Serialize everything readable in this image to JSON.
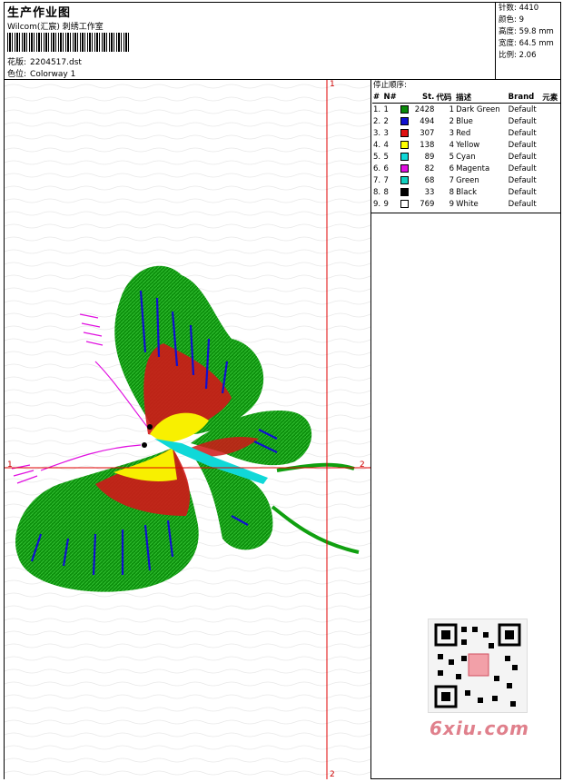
{
  "header": {
    "title": "生产作业图",
    "studio": "Wilcom(汇宸) 刺绣工作室",
    "design_label": "花版:",
    "design_value": "2204517.dst",
    "colorway_label": "色位:",
    "colorway_value": "Colorway 1"
  },
  "stats": {
    "stitches": "针数: 4410",
    "colors": "颜色: 9",
    "height": "高度: 59.8 mm",
    "width": "宽度: 64.5 mm",
    "scale": "比例: 2.06"
  },
  "sequence": {
    "title": "停止顺序:",
    "columns": [
      "#",
      "N#",
      "St.",
      "代码",
      "描述",
      "Brand",
      "元素"
    ],
    "rows": [
      {
        "num": "1.",
        "n": "1",
        "color": "#0a8a0a",
        "st": "2428",
        "code": "1",
        "desc": "Dark Green",
        "brand": "Default"
      },
      {
        "num": "2.",
        "n": "2",
        "color": "#1010d0",
        "st": "494",
        "code": "2",
        "desc": "Blue",
        "brand": "Default"
      },
      {
        "num": "3.",
        "n": "3",
        "color": "#e01010",
        "st": "307",
        "code": "3",
        "desc": "Red",
        "brand": "Default"
      },
      {
        "num": "4.",
        "n": "4",
        "color": "#ffff00",
        "st": "138",
        "code": "4",
        "desc": "Yellow",
        "brand": "Default"
      },
      {
        "num": "5.",
        "n": "5",
        "color": "#10d8d8",
        "st": "89",
        "code": "5",
        "desc": "Cyan",
        "brand": "Default"
      },
      {
        "num": "6.",
        "n": "6",
        "color": "#e010e0",
        "st": "82",
        "code": "6",
        "desc": "Magenta",
        "brand": "Default"
      },
      {
        "num": "7.",
        "n": "7",
        "color": "#10d0c0",
        "st": "68",
        "code": "7",
        "desc": "Green",
        "brand": "Default"
      },
      {
        "num": "8.",
        "n": "8",
        "color": "#000000",
        "st": "33",
        "code": "8",
        "desc": "Black",
        "brand": "Default"
      },
      {
        "num": "9.",
        "n": "9",
        "color": "#ffffff",
        "st": "769",
        "code": "9",
        "desc": "White",
        "brand": "Default"
      }
    ]
  },
  "axes": {
    "v_top": "1",
    "v_bottom": "2",
    "h_left": "1",
    "h_right": "2"
  },
  "watermark": "6xiu.com",
  "colors": {
    "axis": "#e00000",
    "dark_green": "#0a8a0a",
    "red": "#e01010",
    "yellow": "#ffff00",
    "blue": "#1010d0",
    "cyan": "#10d8d8",
    "magenta": "#e010e0"
  }
}
